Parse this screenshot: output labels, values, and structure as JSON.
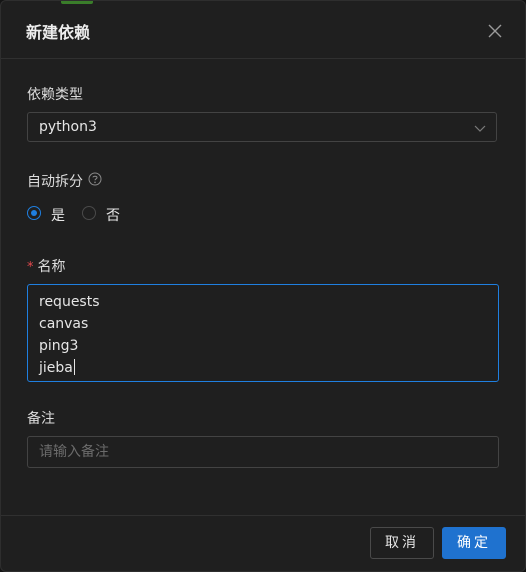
{
  "dialog": {
    "title": "新建依赖"
  },
  "fields": {
    "dep_type": {
      "label": "依赖类型",
      "value": "python3"
    },
    "auto_split": {
      "label": "自动拆分",
      "options": [
        {
          "label": "是",
          "checked": true
        },
        {
          "label": "否",
          "checked": false
        }
      ]
    },
    "name": {
      "required_mark": "*",
      "label": "名称",
      "lines": [
        "requests",
        "canvas",
        "ping3",
        "jieba"
      ]
    },
    "remark": {
      "label": "备注",
      "placeholder": "请输入备注",
      "value": ""
    }
  },
  "footer": {
    "cancel_label": "取消",
    "ok_label": "确定"
  },
  "colors": {
    "accent": "#1f7fe0",
    "primary_button": "#1f72cf",
    "required": "#e5484d",
    "background": "#1f1f1f"
  },
  "icons": {
    "close": "close-icon",
    "select_arrow": "chevron-down-icon",
    "help": "question-circle-icon"
  }
}
